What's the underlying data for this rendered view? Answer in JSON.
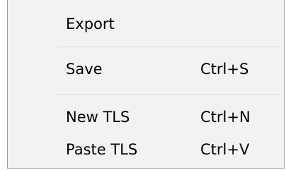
{
  "menu": {
    "items": [
      {
        "label": "Export",
        "shortcut": ""
      },
      {
        "label": "Save",
        "shortcut": "Ctrl+S"
      },
      {
        "label": "New TLS",
        "shortcut": "Ctrl+N"
      },
      {
        "label": "Paste TLS",
        "shortcut": "Ctrl+V"
      }
    ]
  }
}
